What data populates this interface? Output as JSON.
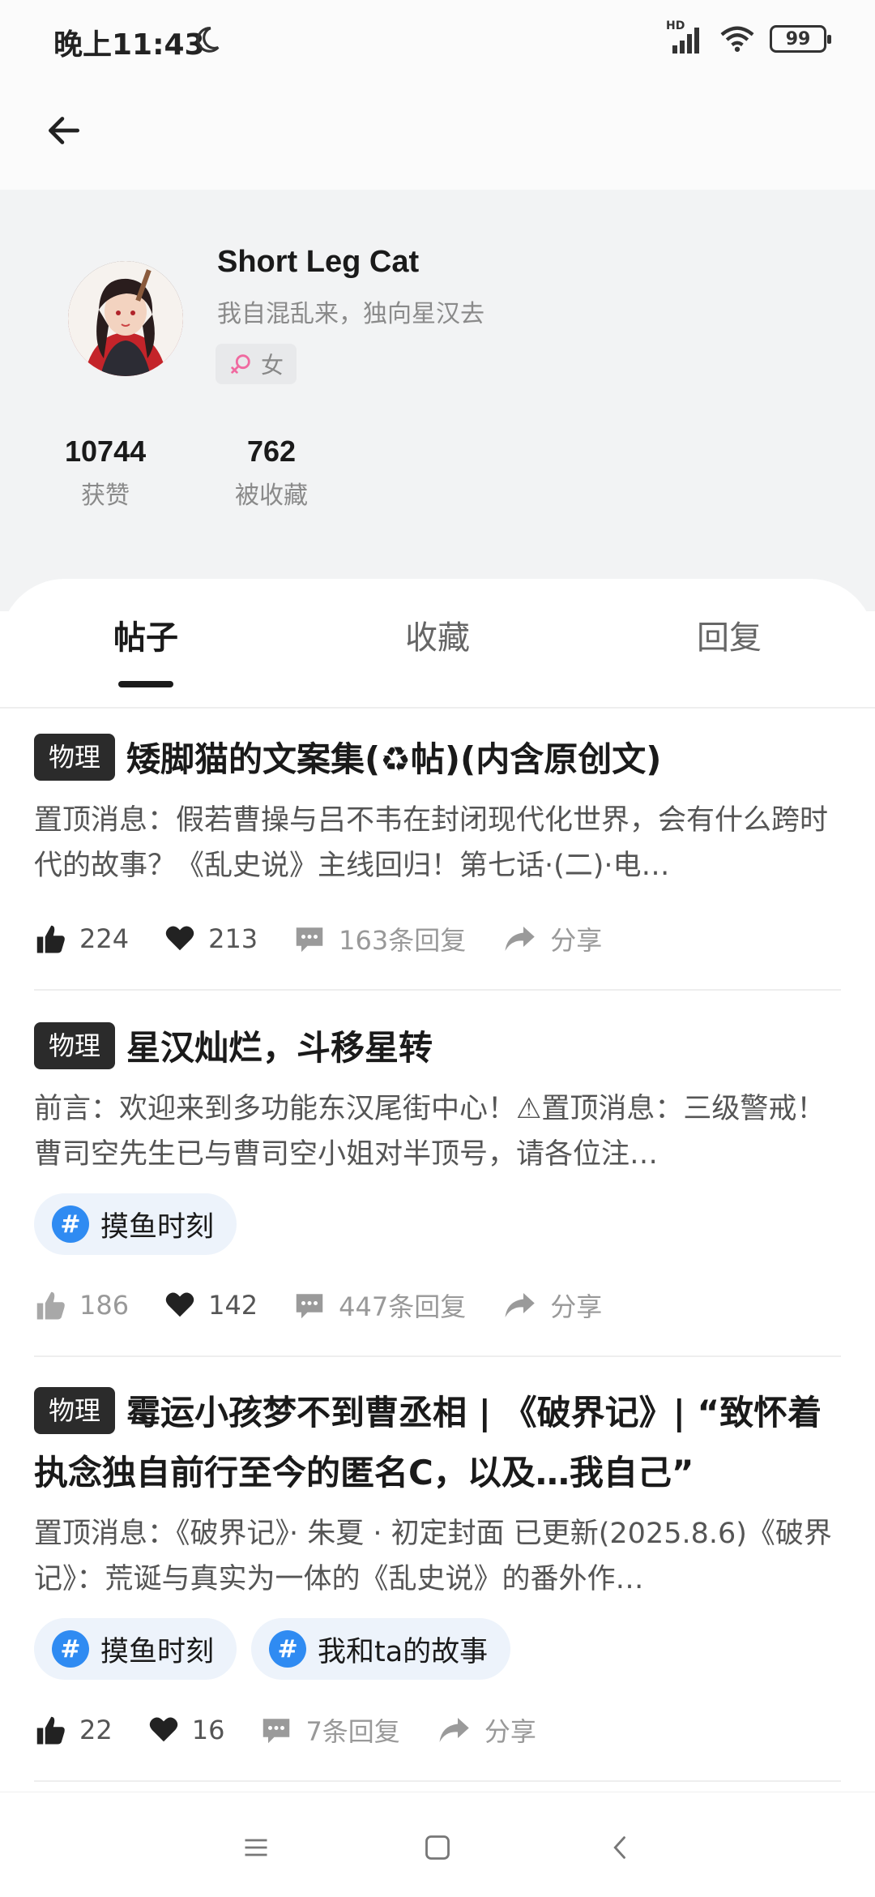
{
  "status_bar": {
    "time": "晚上11:43",
    "signal_label": "HD",
    "battery": "99"
  },
  "profile": {
    "name": "Short Leg Cat",
    "bio": "我自混乱来，独向星汉去",
    "gender": "女",
    "stats": [
      {
        "value": "10744",
        "label": "获赞"
      },
      {
        "value": "762",
        "label": "被收藏"
      }
    ]
  },
  "tabs": [
    {
      "label": "帖子",
      "active": true
    },
    {
      "label": "收藏",
      "active": false
    },
    {
      "label": "回复",
      "active": false
    }
  ],
  "posts": [
    {
      "category": "物理",
      "title": "矮脚猫的文案集(♻帖)(内含原创文)",
      "body": "置顶消息：假若曹操与吕不韦在封闭现代化世界，会有什么跨时代的故事？《乱史说》主线回归！第七话·(二)·电…",
      "tags": [],
      "likes": "224",
      "favorites": "213",
      "replies": "163条回复",
      "share": "分享"
    },
    {
      "category": "物理",
      "title": "星汉灿烂，斗移星转",
      "body": "前言：欢迎来到多功能东汉尾街中心！⚠置顶消息：三级警戒！曹司空先生已与曹司空小姐对半顶号，请各位注…",
      "tags": [
        "摸鱼时刻"
      ],
      "likes": "186",
      "favorites": "142",
      "replies": "447条回复",
      "share": "分享"
    },
    {
      "category": "物理",
      "title": "霉运小孩梦不到曹丞相 | 《破界记》| “致怀着执念独自前行至今的匿名C，以及…我自己”",
      "body": "置顶消息：《破界记》· 朱夏 · 初定封面 已更新(2025.8.6)《破界记》：荒诞与真实为一体的《乱史说》的番外作…",
      "tags": [
        "摸鱼时刻",
        "我和ta的故事"
      ],
      "likes": "22",
      "favorites": "16",
      "replies": "7条回复",
      "share": "分享"
    }
  ],
  "colors": {
    "accent_blue": "#2f8bf2",
    "tag_bg": "#edf3fb",
    "profile_bg": "#f2f3f4",
    "category_bg": "#2b2b2b"
  },
  "icons": [
    "moon-icon",
    "signal-icon",
    "wifi-icon",
    "battery-icon",
    "back-arrow-icon",
    "female-icon",
    "thumbs-up-icon",
    "heart-icon",
    "comment-icon",
    "share-icon",
    "hash-icon",
    "menu-icon",
    "home-icon",
    "back-nav-icon"
  ]
}
